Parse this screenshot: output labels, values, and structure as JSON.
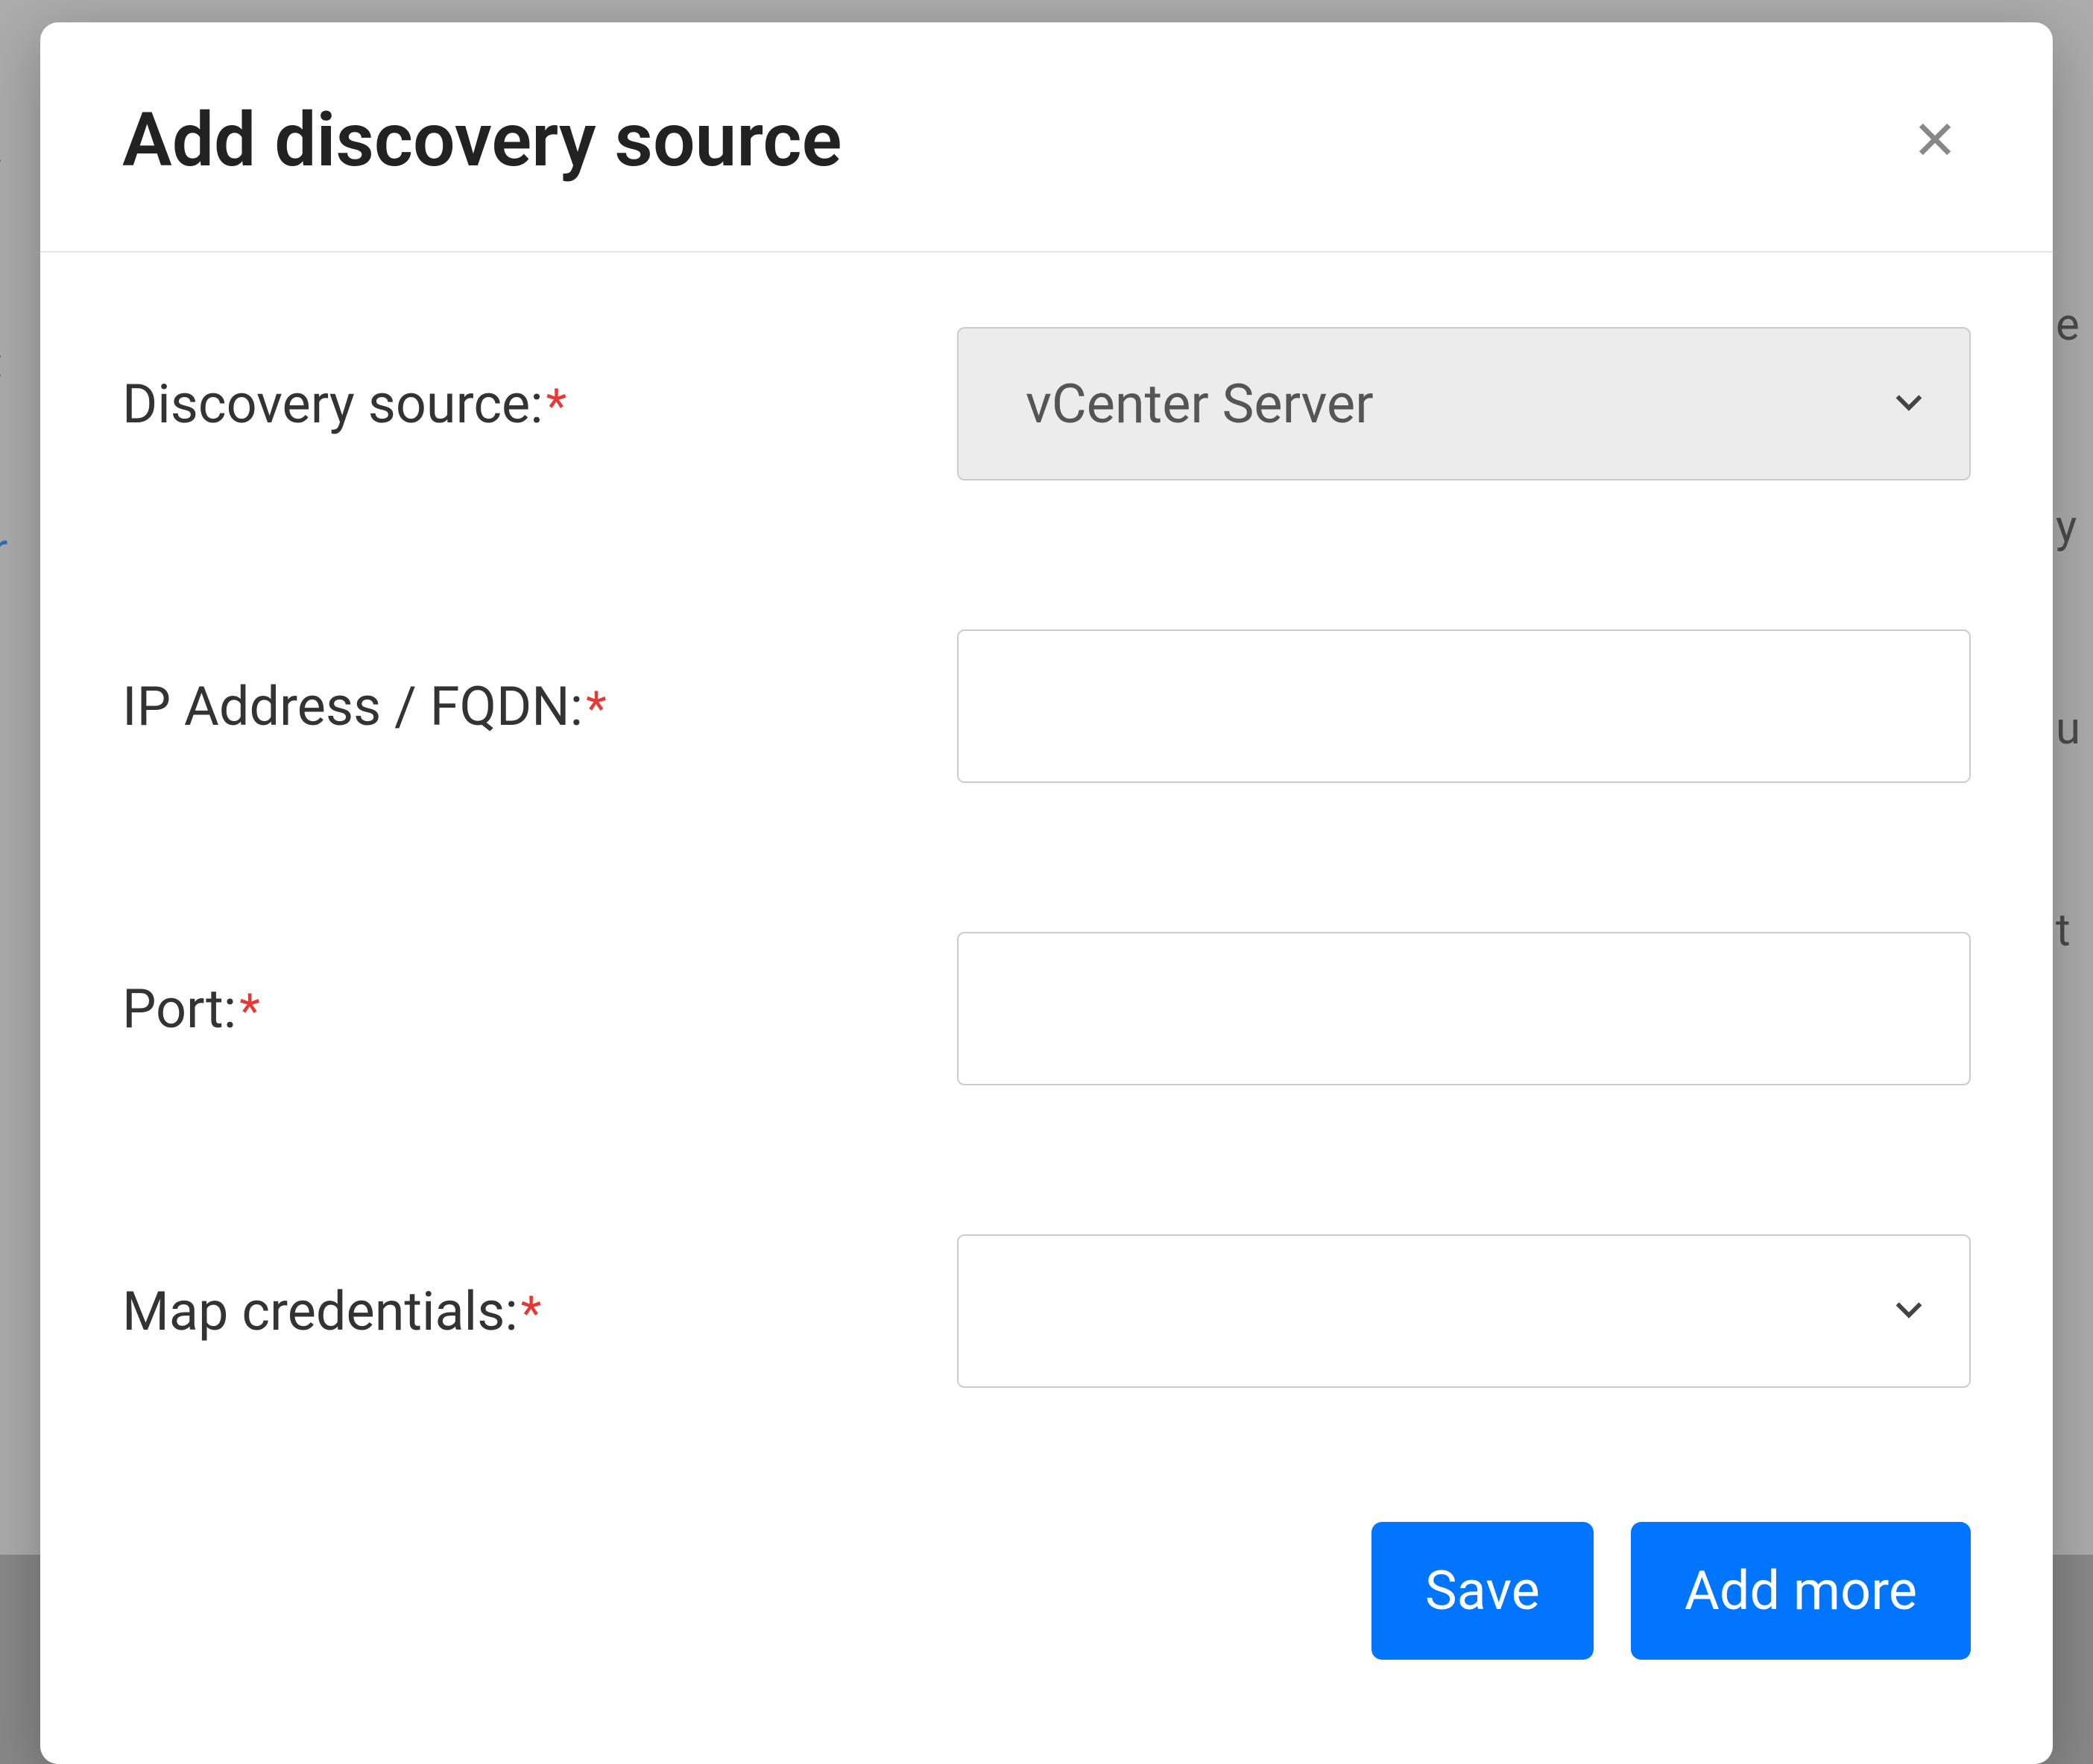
{
  "modal": {
    "title": "Add discovery source",
    "fields": {
      "discovery_source": {
        "label": "Discovery source:",
        "required_mark": "*",
        "value": "vCenter Server"
      },
      "ip_fqdn": {
        "label": "IP Address / FQDN:",
        "required_mark": "*",
        "value": ""
      },
      "port": {
        "label": "Port:",
        "required_mark": "*",
        "value": ""
      },
      "map_credentials": {
        "label": "Map credentials:",
        "required_mark": "*",
        "value": ""
      }
    },
    "actions": {
      "save": "Save",
      "add_more": "Add more"
    }
  },
  "backdrop": {
    "left": [
      "i",
      ":",
      "s",
      "r",
      "",
      "",
      "",
      "",
      "c",
      ":",
      ""
    ],
    "right": [
      "e",
      "y",
      "",
      "u",
      "",
      "",
      "t"
    ]
  }
}
